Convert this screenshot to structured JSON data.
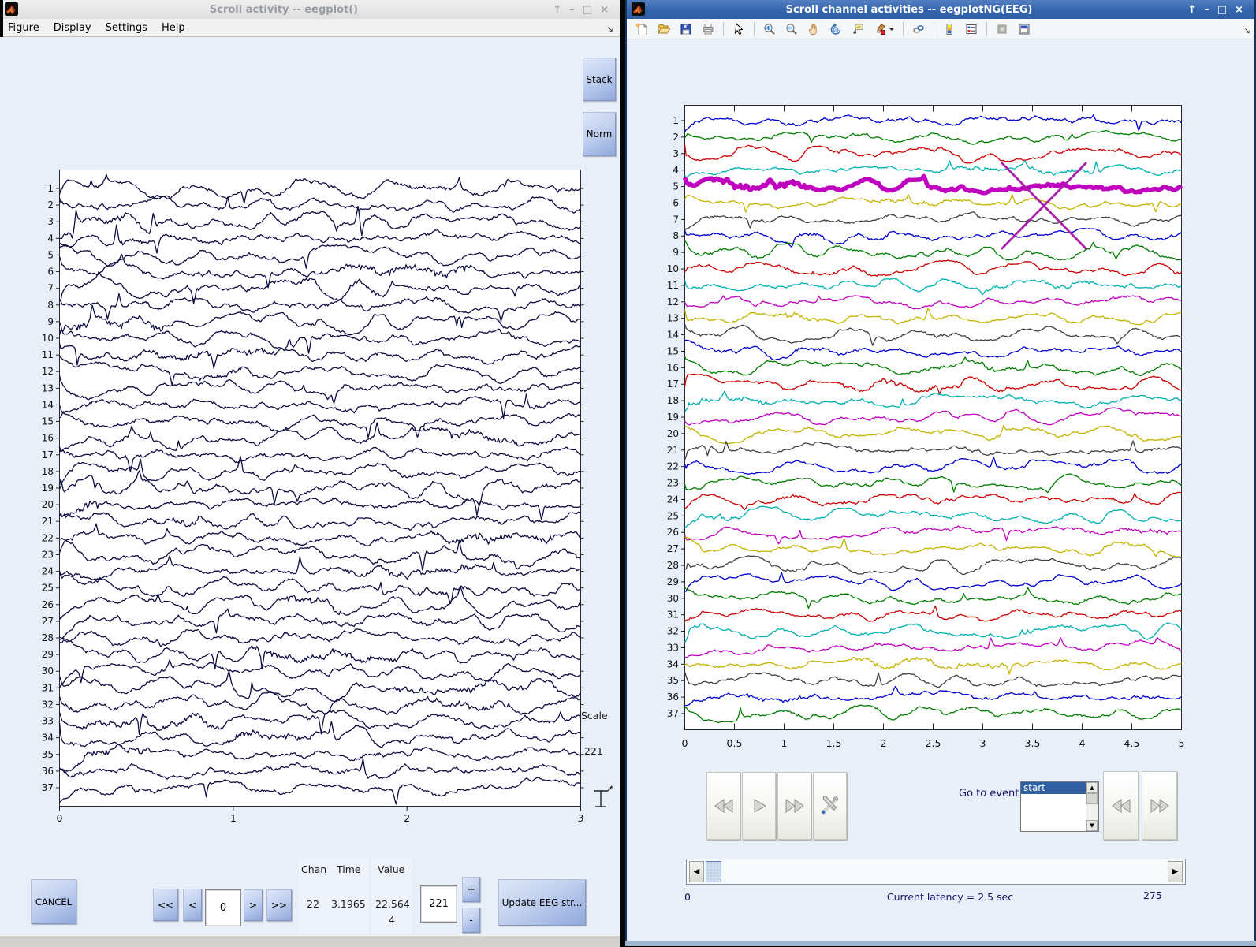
{
  "left_window": {
    "title": "Scroll activity -- eegplot()",
    "menu": [
      "Figure",
      "Display",
      "Settings",
      "Help"
    ],
    "stack_button": "Stack",
    "norm_button": "Norm",
    "scale_label": "Scale",
    "scale_value": "221",
    "controls": {
      "cancel": "CANCEL",
      "prev_page": "<<",
      "prev": "<",
      "position": "0",
      "next": ">",
      "next_page": ">>",
      "col_chan": "Chan",
      "col_time": "Time",
      "col_value": "Value",
      "chan_value": "22",
      "time_value": "3.1965",
      "value_value": "22.564",
      "value_value_line2": "4",
      "scale_input": "221",
      "plus": "+",
      "minus": "-",
      "update": "Update EEG str..."
    }
  },
  "right_window": {
    "title": "Scroll channel activities -- eegplotNG(EEG)",
    "toolbar_icons": [
      "new-figure",
      "open-file",
      "save-figure",
      "print",
      "pointer",
      "zoom-in",
      "zoom-out",
      "pan",
      "rotate-3d",
      "data-cursor",
      "brush",
      "link-plots",
      "insert-colorbar",
      "insert-legend",
      "dock-disabled",
      "dock-window"
    ],
    "goto_event_label": "Go to event",
    "event_options": [
      "start"
    ],
    "selected_event": "start",
    "range_start": "0",
    "latency_text": "Current latency = 2.5 sec",
    "range_end": "275"
  },
  "chart_data": [
    {
      "type": "line",
      "id": "left-eeg-scroll",
      "n_channels": 37,
      "xticks": [
        "0",
        "1",
        "2",
        "3"
      ],
      "xlim": [
        0,
        3
      ],
      "trace_color": "#0d0d42",
      "seed": 20,
      "amplitude": {
        "slow": 5.2,
        "mid": 1.7,
        "fine": 0.7,
        "spike_p": 0.006,
        "spike": 30,
        "burst": 2.6,
        "clamp": 24
      },
      "note": "37-channel EEG activity scroll, uniform dark navy traces"
    },
    {
      "type": "line",
      "id": "right-eeg-scroll",
      "n_channels": 37,
      "xticks": [
        "0",
        "0.5",
        "1",
        "1.5",
        "2",
        "2.5",
        "3",
        "3.5",
        "4",
        "4.5",
        "5"
      ],
      "xlim": [
        0,
        5
      ],
      "color_order": [
        "#0000cd",
        "#007d00",
        "#cd0000",
        "#00b0b0",
        "#bf00bf",
        "#c2b400",
        "#404040"
      ],
      "highlight_channel": 5,
      "amplitude": {
        "slow": 4.3,
        "mid": 1.3,
        "fine": 0.55,
        "spike_p": 0.005,
        "spike": 22,
        "burst": 1.6,
        "clamp": 15
      },
      "annotation": "thick magenta channel 5 with purple X mark near t=3.4s spanning channels 4-8",
      "seed": 7
    }
  ]
}
